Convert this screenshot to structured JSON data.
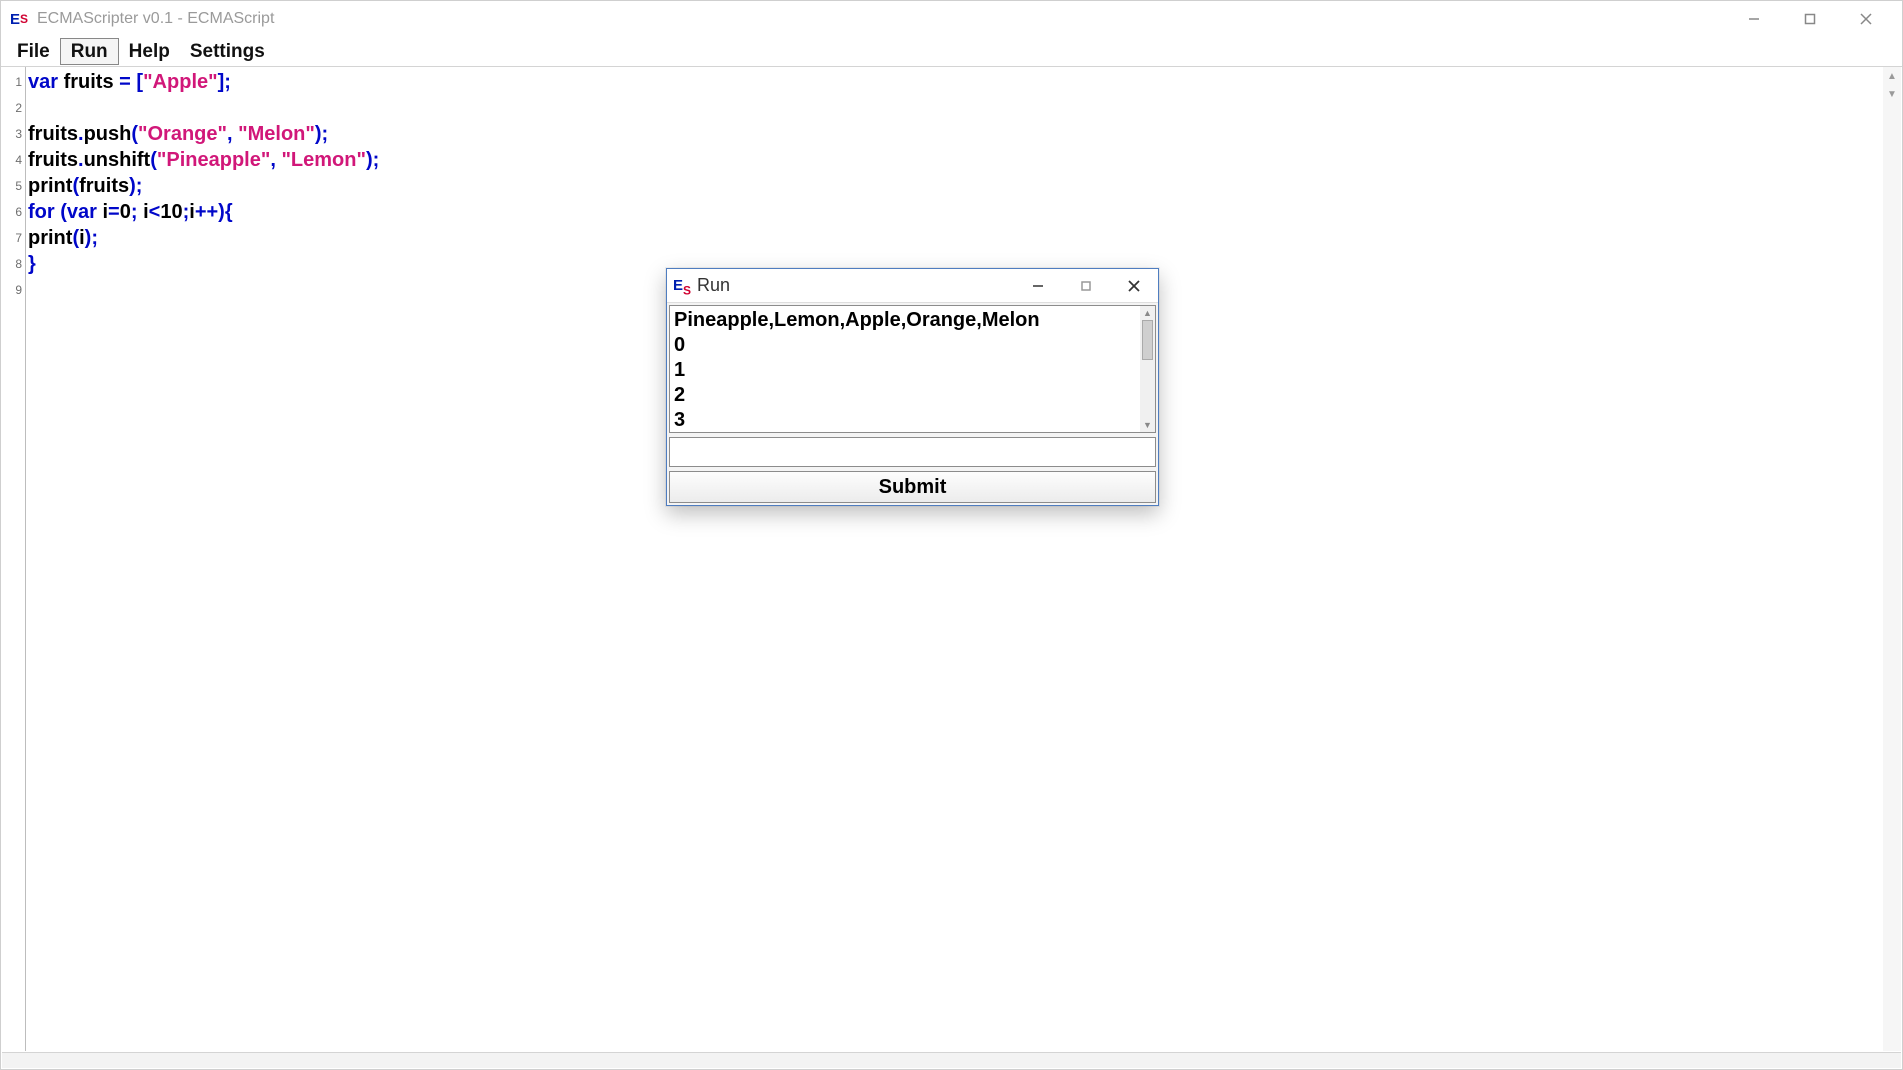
{
  "window": {
    "title": "ECMAScripter v0.1 - ECMAScript"
  },
  "menubar": {
    "items": [
      "File",
      "Run",
      "Help",
      "Settings"
    ],
    "active_index": 1
  },
  "code": {
    "line_numbers": [
      "1",
      "2",
      "3",
      "4",
      "5",
      "6",
      "7",
      "8",
      "9"
    ],
    "lines": [
      [
        {
          "t": "var",
          "c": "kw"
        },
        {
          "t": " fruits "
        },
        {
          "t": "=",
          "c": "kw"
        },
        {
          "t": " "
        },
        {
          "t": "[",
          "c": "kw"
        },
        {
          "t": "\"Apple\"",
          "c": "str"
        },
        {
          "t": "];",
          "c": "kw"
        }
      ],
      [],
      [
        {
          "t": "fruits"
        },
        {
          "t": ".",
          "c": "kw"
        },
        {
          "t": "push"
        },
        {
          "t": "(",
          "c": "kw"
        },
        {
          "t": "\"Orange\"",
          "c": "str"
        },
        {
          "t": ", ",
          "c": "kw"
        },
        {
          "t": "\"Melon\"",
          "c": "str"
        },
        {
          "t": ");",
          "c": "kw"
        }
      ],
      [
        {
          "t": "fruits"
        },
        {
          "t": ".",
          "c": "kw"
        },
        {
          "t": "unshift"
        },
        {
          "t": "(",
          "c": "kw"
        },
        {
          "t": "\"Pineapple\"",
          "c": "str"
        },
        {
          "t": ", ",
          "c": "kw"
        },
        {
          "t": "\"Lemon\"",
          "c": "str"
        },
        {
          "t": ");",
          "c": "kw"
        }
      ],
      [
        {
          "t": "print"
        },
        {
          "t": "(",
          "c": "kw"
        },
        {
          "t": "fruits"
        },
        {
          "t": ");",
          "c": "kw"
        }
      ],
      [
        {
          "t": "for (var",
          "c": "kw"
        },
        {
          "t": " i"
        },
        {
          "t": "=",
          "c": "kw"
        },
        {
          "t": "0"
        },
        {
          "t": ";",
          "c": "kw"
        },
        {
          "t": " i"
        },
        {
          "t": "<",
          "c": "kw"
        },
        {
          "t": "10"
        },
        {
          "t": ";",
          "c": "kw"
        },
        {
          "t": "i"
        },
        {
          "t": "++){",
          "c": "kw"
        }
      ],
      [
        {
          "t": "print"
        },
        {
          "t": "(",
          "c": "kw"
        },
        {
          "t": "i"
        },
        {
          "t": ");",
          "c": "kw"
        }
      ],
      [
        {
          "t": "}",
          "c": "kw"
        }
      ],
      []
    ]
  },
  "run_dialog": {
    "title": "Run",
    "output_lines": [
      "Pineapple,Lemon,Apple,Orange,Melon",
      "0",
      "1",
      "2",
      "3"
    ],
    "input_value": "",
    "submit_label": "Submit"
  }
}
